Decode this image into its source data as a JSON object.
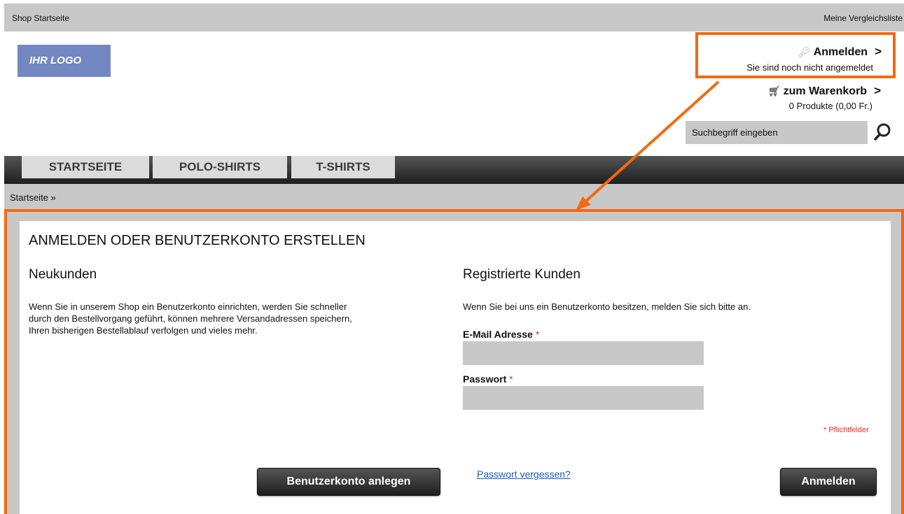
{
  "topbar": {
    "home": "Shop Startseite",
    "compare": "Meine Vergleichsliste"
  },
  "logo": {
    "text": "IHR LOGO"
  },
  "account": {
    "login_label": "Anmelden",
    "status": "Sie sind noch nicht angemeldet",
    "cart_label": "zum Warenkorb",
    "cart_summary": "0 Produkte (0,00 Fr.)"
  },
  "search": {
    "placeholder": "Suchbegriff eingeben"
  },
  "nav": {
    "tabs": [
      "STARTSEITE",
      "POLO-SHIRTS",
      "T-SHIRTS"
    ]
  },
  "breadcrumb": {
    "text": "Startseite »"
  },
  "page": {
    "title": "ANMELDEN ODER BENUTZERKONTO ERSTELLEN",
    "new": {
      "heading": "Neukunden",
      "text_lines": [
        "Wenn Sie in unserem Shop ein Benutzerkonto einrichten, werden Sie schneller",
        "durch den Bestellvorgang geführt, können mehrere Versandadressen speichern,",
        "Ihren bisherigen Bestellablauf verfolgen und vieles mehr."
      ],
      "button": "Benutzerkonto anlegen"
    },
    "registered": {
      "heading": "Registrierte Kunden",
      "text": "Wenn Sie bei uns ein Benutzerkonto besitzen, melden Sie sich bitte an.",
      "email_label": "E-Mail Adresse",
      "password_label": "Passwort",
      "required_mark": "*",
      "required_note": "* Pflichtfelder",
      "forgot": "Passwort vergessen?",
      "button": "Anmelden"
    }
  },
  "colors": {
    "highlight": "#f26a10",
    "accent_link": "#1b5fc1",
    "logo_bg": "#7388c2"
  },
  "icons": {
    "login": "key-icon",
    "cart": "cart-icon",
    "search": "magnifier-icon"
  }
}
